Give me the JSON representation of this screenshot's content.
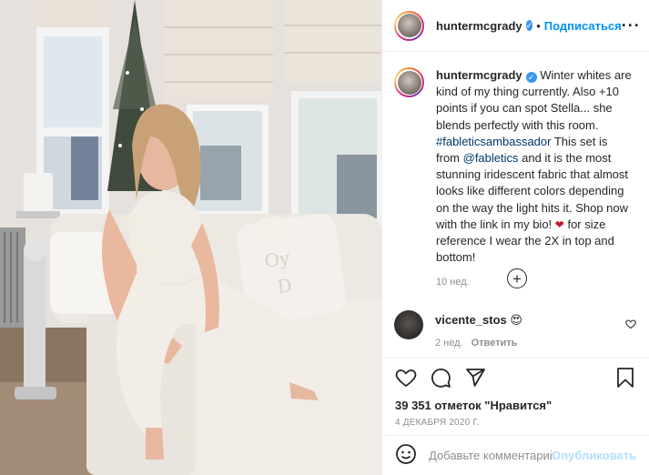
{
  "post": {
    "username": "huntermcgrady",
    "follow_label": "Подписаться",
    "separator": "•"
  },
  "caption": {
    "username": "huntermcgrady",
    "text_part1": "Winter whites are kind of my thing currently. Also +10 points if you can spot Stella... she blends perfectly with this room. ",
    "hashtag": "#fableticsambassador",
    "text_part2": " This set is from ",
    "mention": "@fabletics",
    "text_part3": " and it is the most stunning iridescent fabric that almost looks like different colors depending on the way the light hits it. Shop now with the link in my bio! ",
    "text_part4": " for size reference I wear the 2X in top and bottom!",
    "time_ago": "10 нед."
  },
  "comments": [
    {
      "username": "vicente_stos",
      "emoji": "😍",
      "time_ago": "2 нед.",
      "reply_label": "Ответить"
    }
  ],
  "actions": {
    "likes_text": "39 351 отметок \"Нравится\"",
    "date": "4 ДЕКАБРЯ 2020 Г."
  },
  "comment_input": {
    "placeholder": "Добавьте комментарий...",
    "post_label": "Опубликовать"
  },
  "icons": {
    "verified": "verified-badge-icon",
    "more": "more-options-icon",
    "like": "heart-icon",
    "comment": "comment-icon",
    "share": "share-icon",
    "save": "bookmark-icon",
    "load_more": "plus-circle-icon",
    "emoji": "smiley-icon"
  },
  "colors": {
    "accent": "#0095f6",
    "muted": "#8e8e8e",
    "link": "#00376b"
  }
}
